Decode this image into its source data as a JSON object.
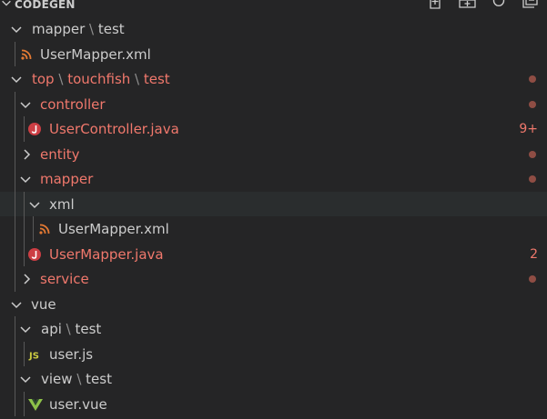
{
  "explorer": {
    "title": "CODEGEN",
    "actions": [
      "new-file-icon",
      "new-folder-icon",
      "refresh-icon",
      "collapse-all-icon"
    ]
  },
  "colors": {
    "background": "#252526",
    "text": "#cccccc",
    "error_text": "#f0786c",
    "selected_row": "#2a2d2e",
    "decoration_dot": "#8f4d44"
  },
  "tree": [
    {
      "parts": [
        "mapper",
        "test"
      ],
      "expanded": true,
      "error": false
    },
    {
      "text": "UserMapper.xml",
      "icon": "rss-icon",
      "error": false
    },
    {
      "parts": [
        "top",
        "touchfish",
        "test"
      ],
      "expanded": true,
      "error": true
    },
    {
      "text": "controller",
      "expanded": true,
      "error": true
    },
    {
      "text": "UserController.java",
      "icon": "java-icon",
      "error": true,
      "badge": "9+"
    },
    {
      "text": "entity",
      "expanded": false,
      "error": true
    },
    {
      "text": "mapper",
      "expanded": true,
      "error": true
    },
    {
      "text": "xml",
      "expanded": true,
      "error": false,
      "selected": true
    },
    {
      "text": "UserMapper.xml",
      "icon": "rss-icon",
      "error": false
    },
    {
      "text": "UserMapper.java",
      "icon": "java-icon",
      "error": true,
      "badge": "2"
    },
    {
      "text": "service",
      "expanded": false,
      "error": true
    },
    {
      "text": "vue",
      "expanded": true,
      "error": false
    },
    {
      "parts": [
        "api",
        "test"
      ],
      "expanded": true,
      "error": false
    },
    {
      "text": "user.js",
      "icon": "js-icon",
      "error": false
    },
    {
      "parts": [
        "view",
        "test"
      ],
      "expanded": true,
      "error": false
    },
    {
      "text": "user.vue",
      "icon": "vue-icon",
      "error": false
    }
  ]
}
